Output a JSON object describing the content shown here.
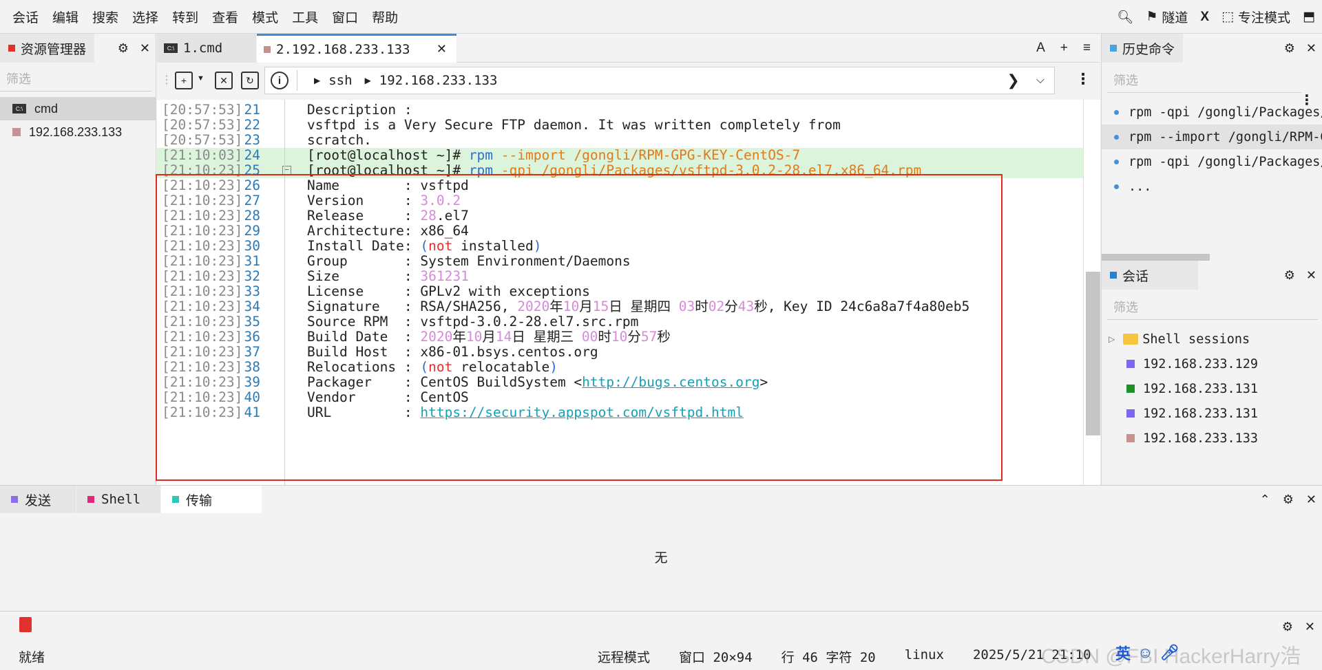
{
  "menubar": {
    "items": [
      "会话",
      "编辑",
      "搜索",
      "选择",
      "转到",
      "查看",
      "模式",
      "工具",
      "窗口",
      "帮助"
    ],
    "right": {
      "tunnel": "隧道",
      "x": "X",
      "focus": "专注模式"
    }
  },
  "explorer": {
    "title": "资源管理器",
    "filter_placeholder": "筛选",
    "items": [
      {
        "label": "cmd",
        "icon": "cmd-icon"
      },
      {
        "label": "192.168.233.133",
        "icon": "session-square-icon",
        "color": "#c49390"
      }
    ]
  },
  "tabs": [
    {
      "label": "1.cmd"
    },
    {
      "label": "2.192.168.233.133",
      "color": "#c49390"
    }
  ],
  "tab_tools": {
    "font": "A",
    "add": "+",
    "menu": "≡"
  },
  "address": {
    "protocol": "ssh",
    "host": "192.168.233.133"
  },
  "terminal": {
    "lines": [
      {
        "ts": "[20:57:53]",
        "ln": "21",
        "segs": [
          [
            "Description : ",
            ""
          ]
        ]
      },
      {
        "ts": "[20:57:53]",
        "ln": "22",
        "segs": [
          [
            "vsftpd is a Very Secure FTP daemon. It was written completely from",
            ""
          ]
        ]
      },
      {
        "ts": "[20:57:53]",
        "ln": "23",
        "segs": [
          [
            "scratch.",
            ""
          ]
        ]
      },
      {
        "ts": "[21:10:03]",
        "ln": "24",
        "hl": true,
        "segs": [
          [
            "[root@localhost ~]# ",
            ""
          ],
          [
            "rpm ",
            "cmdc"
          ],
          [
            "--import /gongli/RPM-GPG-KEY-CentOS-7",
            "argc"
          ]
        ]
      },
      {
        "ts": "[21:10:23]",
        "ln": "25",
        "hl": true,
        "fold": true,
        "segs": [
          [
            "[root@localhost ~]# ",
            ""
          ],
          [
            "rpm ",
            "cmdc"
          ],
          [
            "-qpi /gongli/Packages/vsftpd-3.0.2-28.el7.x86_64.rpm",
            "argc"
          ]
        ]
      },
      {
        "ts": "[21:10:23]",
        "ln": "26",
        "segs": [
          [
            "Name        : vsftpd",
            ""
          ]
        ]
      },
      {
        "ts": "[21:10:23]",
        "ln": "27",
        "segs": [
          [
            "Version     : ",
            ""
          ],
          [
            "3.0.2",
            "num"
          ]
        ]
      },
      {
        "ts": "[21:10:23]",
        "ln": "28",
        "segs": [
          [
            "Release     : ",
            ""
          ],
          [
            "28",
            "num"
          ],
          [
            ".el7",
            ""
          ]
        ]
      },
      {
        "ts": "[21:10:23]",
        "ln": "29",
        "segs": [
          [
            "Architecture: x86_64",
            ""
          ]
        ]
      },
      {
        "ts": "[21:10:23]",
        "ln": "30",
        "segs": [
          [
            "Install Date: ",
            ""
          ],
          [
            "(",
            "par"
          ],
          [
            "not",
            "red"
          ],
          [
            " installed",
            ""
          ],
          [
            ")",
            "par"
          ]
        ]
      },
      {
        "ts": "[21:10:23]",
        "ln": "31",
        "segs": [
          [
            "Group       : System Environment/Daemons",
            ""
          ]
        ]
      },
      {
        "ts": "[21:10:23]",
        "ln": "32",
        "segs": [
          [
            "Size        : ",
            ""
          ],
          [
            "361231",
            "num"
          ]
        ]
      },
      {
        "ts": "[21:10:23]",
        "ln": "33",
        "segs": [
          [
            "License     : GPLv2 with exceptions",
            ""
          ]
        ]
      },
      {
        "ts": "[21:10:23]",
        "ln": "34",
        "segs": [
          [
            "Signature   : RSA/SHA256, ",
            ""
          ],
          [
            "2020",
            "num"
          ],
          [
            "年",
            ""
          ],
          [
            "10",
            "num"
          ],
          [
            "月",
            ""
          ],
          [
            "15",
            "num"
          ],
          [
            "日 星期四 ",
            ""
          ],
          [
            "03",
            "num"
          ],
          [
            "时",
            ""
          ],
          [
            "02",
            "num"
          ],
          [
            "分",
            ""
          ],
          [
            "43",
            "num"
          ],
          [
            "秒, Key ID 24c6a8a7f4a80eb5",
            ""
          ]
        ]
      },
      {
        "ts": "[21:10:23]",
        "ln": "35",
        "segs": [
          [
            "Source RPM  : vsftpd-3.0.2-28.el7.src.rpm",
            ""
          ]
        ]
      },
      {
        "ts": "[21:10:23]",
        "ln": "36",
        "segs": [
          [
            "Build Date  : ",
            ""
          ],
          [
            "2020",
            "num"
          ],
          [
            "年",
            ""
          ],
          [
            "10",
            "num"
          ],
          [
            "月",
            ""
          ],
          [
            "14",
            "num"
          ],
          [
            "日 星期三 ",
            ""
          ],
          [
            "00",
            "num"
          ],
          [
            "时",
            ""
          ],
          [
            "10",
            "num"
          ],
          [
            "分",
            ""
          ],
          [
            "57",
            "num"
          ],
          [
            "秒",
            ""
          ]
        ]
      },
      {
        "ts": "[21:10:23]",
        "ln": "37",
        "segs": [
          [
            "Build Host  : x86-01.bsys.centos.org",
            ""
          ]
        ]
      },
      {
        "ts": "[21:10:23]",
        "ln": "38",
        "segs": [
          [
            "Relocations : ",
            ""
          ],
          [
            "(",
            "par"
          ],
          [
            "not",
            "red"
          ],
          [
            " relocatable",
            ""
          ],
          [
            ")",
            "par"
          ]
        ]
      },
      {
        "ts": "[21:10:23]",
        "ln": "39",
        "segs": [
          [
            "Packager    : CentOS BuildSystem <",
            ""
          ],
          [
            "http://bugs.centos.org",
            "link"
          ],
          [
            ">",
            ""
          ]
        ]
      },
      {
        "ts": "[21:10:23]",
        "ln": "40",
        "segs": [
          [
            "Vendor      : CentOS",
            ""
          ]
        ]
      },
      {
        "ts": "[21:10:23]",
        "ln": "41",
        "segs": [
          [
            "URL         : ",
            ""
          ],
          [
            "https://security.appspot.com/vsftpd.html",
            "link"
          ]
        ]
      }
    ]
  },
  "history": {
    "title": "历史命令",
    "filter_placeholder": "筛选",
    "items": [
      "rpm -qpi /gongli/Packages/v",
      "rpm --import /gongli/RPM-GP",
      "rpm -qpi /gongli/Packages/v",
      "..."
    ]
  },
  "sessions": {
    "title": "会话",
    "filter_placeholder": "筛选",
    "folder": "Shell sessions",
    "items": [
      {
        "label": "192.168.233.129",
        "color": "#7b68ee"
      },
      {
        "label": "192.168.233.131",
        "color": "#1f8f2a"
      },
      {
        "label": "192.168.233.131",
        "color": "#7b68ee"
      },
      {
        "label": "192.168.233.133",
        "color": "#c49390"
      }
    ]
  },
  "bottom": {
    "tabs": [
      {
        "label": "发送",
        "color": "#8a6ee6"
      },
      {
        "label": "Shell",
        "color": "#e0287a"
      },
      {
        "label": "传输",
        "color": "#2cc9b8"
      }
    ],
    "empty": "无"
  },
  "status": {
    "ready": "就绪",
    "mode": "远程模式",
    "window": "窗口 20×94",
    "position": "行 46 字符 20",
    "os": "linux",
    "datetime": "2025/5/21 21:10",
    "watermark": "CSDN @FBI HackerHarry浩",
    "ime": "英"
  }
}
